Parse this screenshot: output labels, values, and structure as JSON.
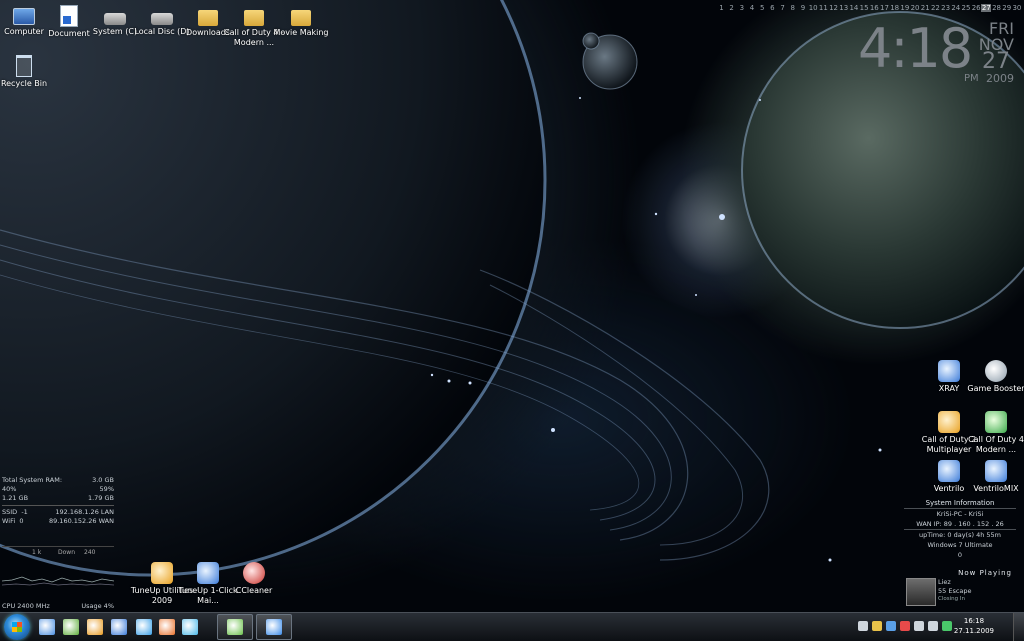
{
  "desktop": {
    "top_icons": [
      {
        "label": "Computer",
        "icon": "computer-icon"
      },
      {
        "label": "Document",
        "icon": "document-icon"
      },
      {
        "label": "System (C)",
        "icon": "drive-icon"
      },
      {
        "label": "Local Disc (D)",
        "icon": "drive-icon"
      },
      {
        "label": "Downloads",
        "icon": "folder-icon"
      },
      {
        "label": "Call of Duty 4 - Modern ...",
        "icon": "folder-icon"
      },
      {
        "label": "Movie Making",
        "icon": "folder-icon"
      }
    ],
    "recycle_bin": {
      "label": "Recycle Bin",
      "icon": "recycle-bin-icon"
    },
    "bottom_icons": [
      {
        "label": "TuneUp Utilities 2009",
        "icon": "tuneup-icon"
      },
      {
        "label": "TuneUp 1-Click Mai...",
        "icon": "tuneup-1click-icon"
      },
      {
        "label": "CCleaner",
        "icon": "ccleaner-icon"
      }
    ],
    "right_icons": [
      {
        "label": "XRAY",
        "icon": "xray-icon"
      },
      {
        "label": "Game Booster",
        "icon": "game-booster-icon"
      },
      {
        "label": "Call of Duty 2 Multiplayer",
        "icon": "cod2-icon"
      },
      {
        "label": "Call Of Duty 4 Modern ...",
        "icon": "cod4-icon"
      },
      {
        "label": "Ventrilo",
        "icon": "ventrilo-icon"
      },
      {
        "label": "VentriloMIX",
        "icon": "ventrilomix-icon"
      }
    ]
  },
  "calendar": {
    "days": [
      "1",
      "2",
      "3",
      "4",
      "5",
      "6",
      "7",
      "8",
      "9",
      "10",
      "11",
      "12",
      "13",
      "14",
      "15",
      "16",
      "17",
      "18",
      "19",
      "20",
      "21",
      "22",
      "23",
      "24",
      "25",
      "26",
      "27",
      "28",
      "29",
      "30"
    ],
    "today": "27"
  },
  "clock": {
    "time": "4:18",
    "weekday": "FRI",
    "month": "NOV",
    "day": "27",
    "ampm": "PM",
    "year": "2009"
  },
  "system_left": {
    "ram_label": "Total System RAM:",
    "ram_total": "3.0 GB",
    "ram_pct_a": "40%",
    "ram_pct_b": "59%",
    "ram_used": "1.21 GB",
    "ram_free": "1.79 GB",
    "ssid_label": "SSID",
    "ssid_val": "-1",
    "lan_ip": "192.168.1.26",
    "lan_label": "LAN",
    "wifi_label": "WiFi",
    "wifi_val": "0",
    "wan_ip": "89.160.152.26",
    "wan_label": "WAN",
    "graph_left": "1 k",
    "graph_mid": "Down",
    "graph_right": "240",
    "cpu": "CPU 2400 MHz",
    "usage": "Usage 4%"
  },
  "system_info": {
    "title": "System Information",
    "host": "KriSi-PC - KriSi",
    "wan": "WAN IP: 89 . 160 . 152 . 26",
    "uptime": "upTime: 0 day(s) 4h 55m",
    "os": "Windows 7 Ultimate",
    "extra": "0"
  },
  "now_playing": {
    "title": "Now Playing",
    "artist": "Liez",
    "track": "55 Escape",
    "status": "Closing In"
  },
  "taskbar": {
    "apps": [
      {
        "name": "windows-explorer-icon",
        "color": "#4a8ee0"
      },
      {
        "name": "utorrent-icon",
        "color": "#5fae3b"
      },
      {
        "name": "outlook-icon",
        "color": "#e89a20"
      },
      {
        "name": "media-center-icon",
        "color": "#3a7ad8"
      },
      {
        "name": "internet-explorer-icon",
        "color": "#3aa0e8"
      },
      {
        "name": "firefox-icon",
        "color": "#e8702a"
      },
      {
        "name": "messenger-icon",
        "color": "#4ab8e8"
      },
      {
        "name": "live-messenger-icon",
        "color": "#6ac04a"
      },
      {
        "name": "media-player-icon",
        "color": "#3a8ae8"
      }
    ],
    "tray_colors": [
      "#cfd6dd",
      "#e8c24a",
      "#5aa0e8",
      "#e84a4a",
      "#cfd6dd",
      "#cfd6dd",
      "#4ac86a"
    ],
    "time": "16:18",
    "date": "27.11.2009"
  }
}
